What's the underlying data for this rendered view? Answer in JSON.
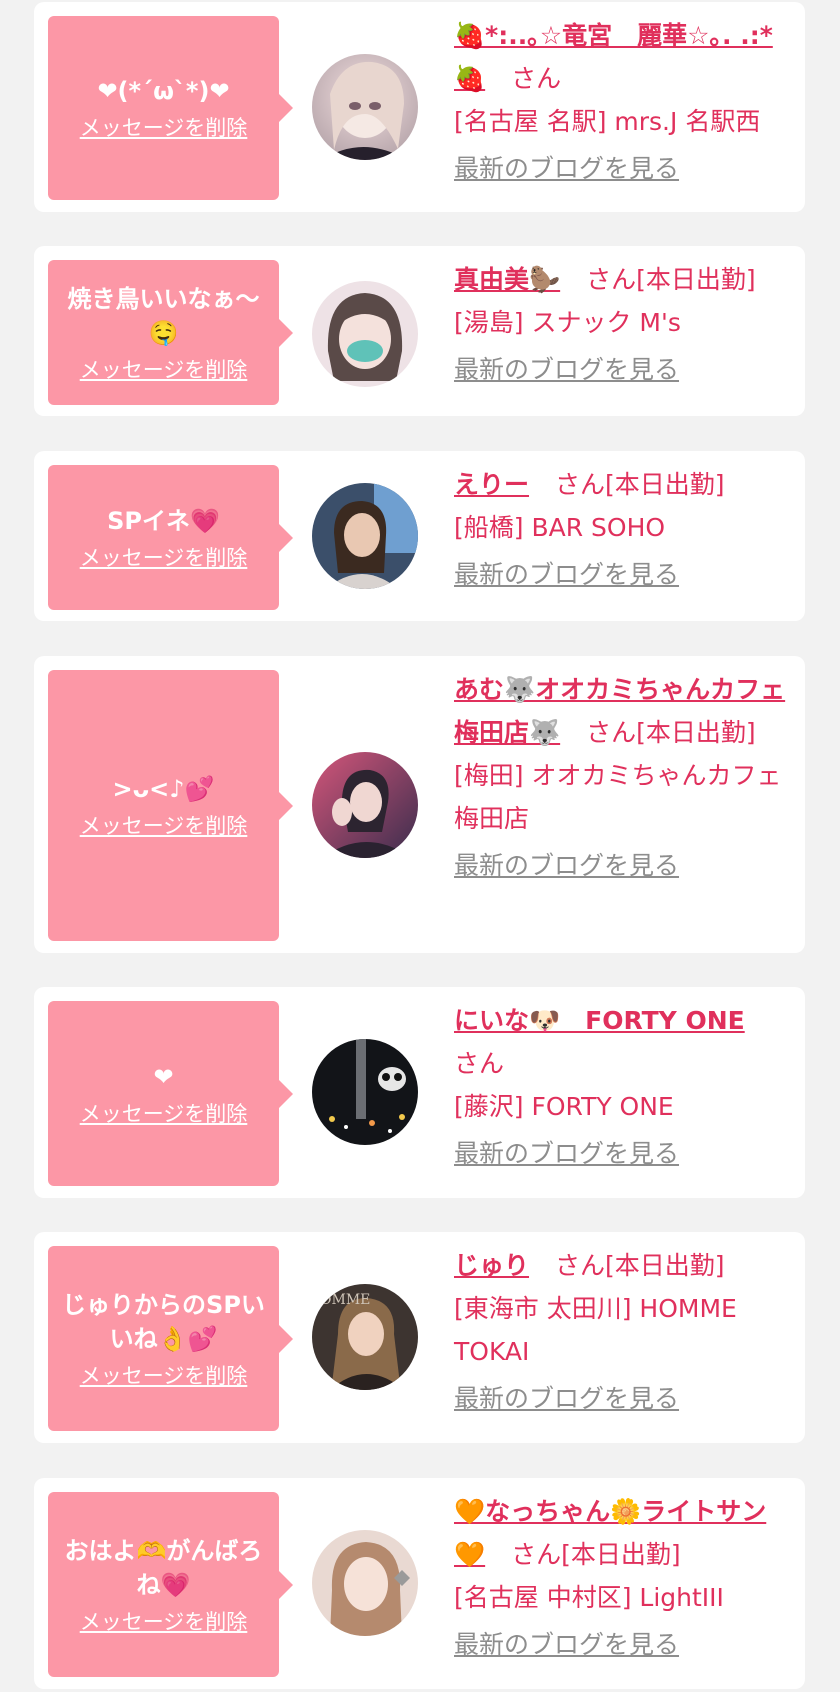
{
  "colors": {
    "page_bg": "#f2f2f2",
    "card_bg": "#ffffff",
    "bubble_bg": "#fc97a6",
    "accent_pink": "#e0305c",
    "link_gray": "#8d8d8d"
  },
  "delete_label": "メッセージを削除",
  "blog_label": "最新のブログを見る",
  "messages": [
    {
      "message": "❤(*´ω`*)❤",
      "name": "🍓*:..｡☆竜宮　麗華☆｡. .:*🍓",
      "suffix": "さん",
      "shop": "[名古屋 名駅] mrs.J 名駅西"
    },
    {
      "message": "焼き鳥いいなぁ〜🤤",
      "name": "真由美🦫",
      "suffix": "さん[本日出勤]",
      "shop": "[湯島] スナック M's"
    },
    {
      "message": "SPイネ💗",
      "name": "えりー",
      "suffix": "さん[本日出勤]",
      "shop": "[船橋] BAR SOHO"
    },
    {
      "message": ">ᴗ<♪💕",
      "name": "あむ🐺オオカミちゃんカフェ梅田店🐺",
      "suffix": "さん[本日出勤]",
      "shop": "[梅田] オオカミちゃんカフェ梅田店"
    },
    {
      "message": "❤",
      "name": "にいな🐶　FORTY ONE",
      "suffix": "さん",
      "shop": "[藤沢] FORTY ONE"
    },
    {
      "message": "じゅりからのSPいいね👌💕",
      "name": "じゅり",
      "suffix": "さん[本日出勤]",
      "shop": "[東海市 太田川] HOMME TOKAI"
    },
    {
      "message": "おはよ🫶がんばろね💗",
      "name": "🧡なっちゃん🌼ライトサン🧡",
      "suffix": "さん[本日出勤]",
      "shop": "[名古屋 中村区] LightIII"
    }
  ]
}
